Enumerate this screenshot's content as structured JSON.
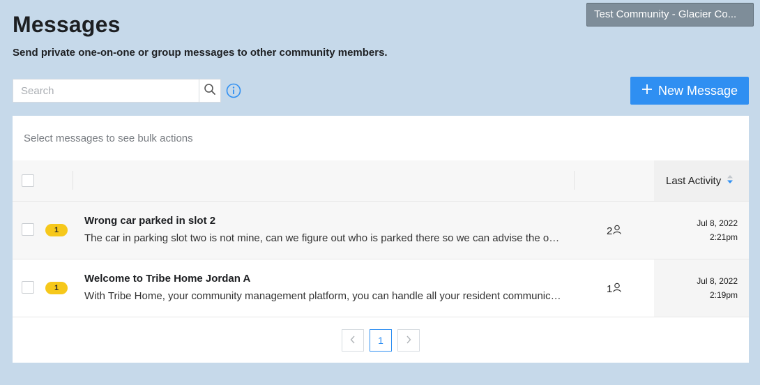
{
  "community": {
    "label": "Test Community - Glacier Co..."
  },
  "header": {
    "title": "Messages",
    "subtitle": "Send private one-on-one or group messages to other community members."
  },
  "search": {
    "placeholder": "Search",
    "value": ""
  },
  "actions": {
    "new_message_label": "New Message"
  },
  "table": {
    "bulk_hint": "Select messages to see bulk actions",
    "columns": {
      "last_activity": "Last Activity"
    },
    "rows": [
      {
        "unread": "1",
        "title": "Wrong car parked in slot 2",
        "preview": "The car in parking slot two is not mine, can we figure out who is parked there so we can advise the owner to move it as soon as possible",
        "participants": "2",
        "date": "Jul 8, 2022",
        "time": "2:21pm"
      },
      {
        "unread": "1",
        "title": "Welcome to Tribe Home Jordan A",
        "preview": "With Tribe Home, your community management platform, you can handle all your resident communication in one place",
        "participants": "1",
        "date": "Jul 8, 2022",
        "time": "2:19pm"
      }
    ]
  },
  "pagination": {
    "current_page": "1",
    "prev_label": "‹",
    "next_label": "›"
  },
  "colors": {
    "background": "#c6d9ea",
    "accent": "#2f8ff2",
    "badge": "#f6c81b",
    "community_button": "#7e8d99"
  },
  "icons": {
    "search": "search-icon",
    "info": "info-icon",
    "plus": "plus-icon",
    "sort": "sort-icon",
    "person": "person-icon",
    "prev": "chevron-left-icon",
    "next": "chevron-right-icon"
  }
}
